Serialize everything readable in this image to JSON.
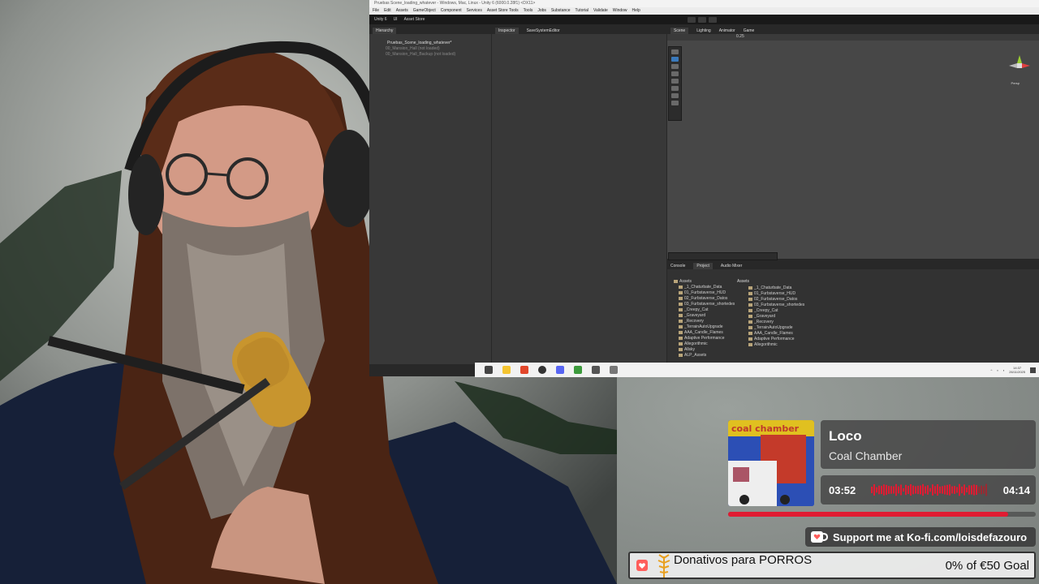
{
  "unity": {
    "window_title": "Pruebas Scene_loading_whatever - Windows, Mac, Linux - Unity 6 (6000.0.28f1) <DX11>",
    "menu": [
      "File",
      "Edit",
      "Assets",
      "GameObject",
      "Component",
      "Services",
      "Asset Store Tools",
      "Tools",
      "Jobs",
      "Substance",
      "Tutorial",
      "Validate",
      "Window",
      "Help"
    ],
    "toolbar": {
      "account": "Unity 6",
      "cloud": "UI",
      "asset_store": "Asset Store"
    },
    "hierarchy": {
      "tab": "Hierarchy",
      "rows": [
        "Pruebas_Scene_loading_whatever*",
        "00_Mansion_Hall (not loaded)",
        "00_Mansion_Hall_Backup (not loaded)"
      ]
    },
    "inspector": {
      "tabs": [
        "Inspector",
        "SaveSystemEditor"
      ]
    },
    "scene": {
      "tabs": [
        "Scene",
        "Lighting",
        "Animator",
        "Game"
      ],
      "zoom": "0.25",
      "persp_label": "Persp"
    },
    "bottom": {
      "tabs": [
        "Console",
        "Project",
        "Audio Mixer"
      ],
      "assets_header": "Assets",
      "tree": [
        "_1_Chaturbate_Data",
        "01_Furbstaverse_HUD",
        "02_Furbstaverse_Datos",
        "03_Furbstaverse_shortedes",
        "_Creepy_Cat",
        "_Graveyard",
        "_Recovery",
        "_TerrainAutoUpgrade",
        "AAA_Candle_Flames",
        "Adaptive Performance",
        "Allegorithmic",
        "Allsky",
        "ALP_Assets"
      ],
      "grid": [
        "_1_Chaturbate_Data",
        "01_Furbstaverse_HUD",
        "02_Furbstaverse_Datos",
        "03_Furbstaverse_shortedes",
        "_Creepy_Cat",
        "_Graveyard",
        "_Recovery",
        "_TerrainAutoUpgrade",
        "AAA_Candle_Flames",
        "Adaptive Performance",
        "Allegorithmic"
      ]
    }
  },
  "taskbar": {
    "time": "14:37",
    "date": "26/11/2025",
    "icons": [
      "taskview-icon",
      "file-explorer-icon",
      "brave-browser-icon",
      "obs-icon",
      "discord-icon",
      "notepad-icon",
      "unity-hub-icon",
      "settings-icon"
    ]
  },
  "now_playing": {
    "title": "Loco",
    "artist": "Coal Chamber",
    "elapsed": "03:52",
    "duration": "04:14",
    "progress": 0.91,
    "album_text": "coal chamber"
  },
  "kofi": {
    "text": "Support me at Ko-fi.com/loisdefazouro"
  },
  "goal": {
    "title": "Donativos para PORROS",
    "status": "0% of €50 Goal",
    "progress": 0
  }
}
